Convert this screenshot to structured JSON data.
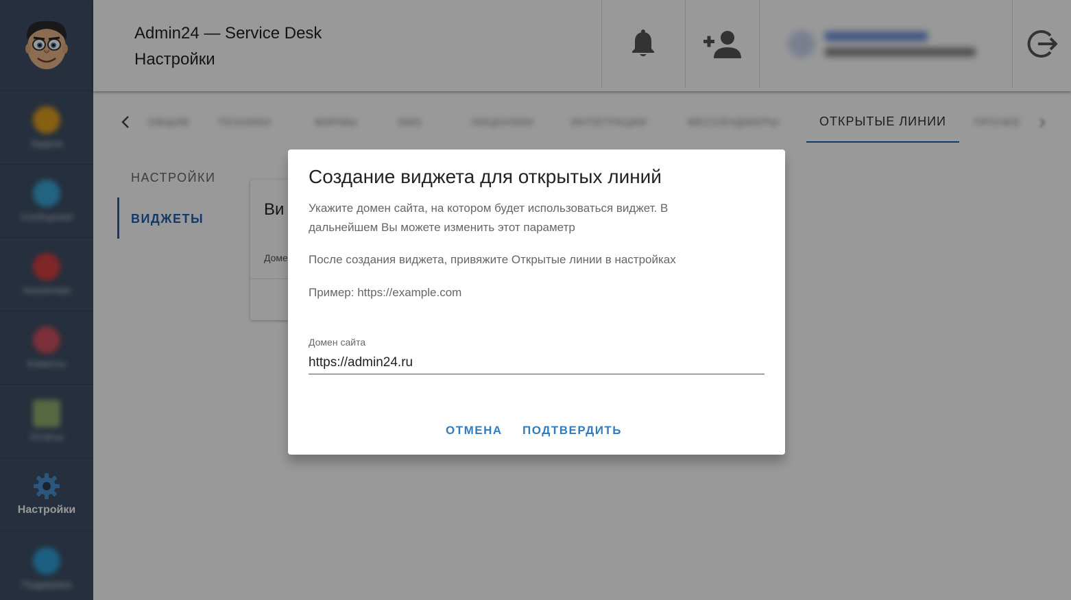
{
  "header": {
    "title": "Admin24 — Service Desk",
    "subtitle": "Настройки"
  },
  "sidebar": {
    "items": [
      {
        "label": "Задачи",
        "icon": "tasks-icon",
        "color": "#e0a020"
      },
      {
        "label": "Сообщения",
        "icon": "chat-icon",
        "color": "#3aa7d8"
      },
      {
        "label": "Аналитика",
        "icon": "analytics-icon",
        "color": "#d84040"
      },
      {
        "label": "Клиенты",
        "icon": "clients-icon",
        "color": "#d05060"
      },
      {
        "label": "Отчёты",
        "icon": "reports-icon",
        "color": "#8fb070"
      },
      {
        "label": "Настройки",
        "icon": "gear-icon",
        "color": "#4a8fd0"
      },
      {
        "label": "Поддержка",
        "icon": "support-icon",
        "color": "#2fa0d8"
      }
    ]
  },
  "tabs": [
    {
      "label": "ОБЩИЕ"
    },
    {
      "label": "ТЕХНИКИ"
    },
    {
      "label": "ФИРМЫ"
    },
    {
      "label": "SMS"
    },
    {
      "label": "ЛИЦЕНЗИИ"
    },
    {
      "label": "ИНТЕГРАЦИИ"
    },
    {
      "label": "МЕССЕНДЖЕРЫ"
    },
    {
      "label": "ОТКРЫТЫЕ ЛИНИИ"
    },
    {
      "label": "ПРОЧЕЕ"
    }
  ],
  "subnav": {
    "settings": "НАСТРОЙКИ",
    "widgets": "ВИДЖЕТЫ"
  },
  "bgcard": {
    "title": "Ви",
    "label": "Доме"
  },
  "dialog": {
    "title": "Создание виджета для открытых линий",
    "text1": "Укажите домен сайта, на котором будет использоваться виджет. В дальнейшем Вы можете изменить этот параметр",
    "text2": "После создания виджета, привяжите Открытые линии в настройках",
    "text3": "Пример: https://example.com",
    "field_label": "Домен сайта",
    "field_value": "https://admin24.ru",
    "cancel": "ОТМЕНА",
    "confirm": "ПОДТВЕРДИТЬ"
  },
  "colors": {
    "sidebar": "#3f4f66",
    "accent": "#1f5fae",
    "button": "#2f7dc0"
  }
}
